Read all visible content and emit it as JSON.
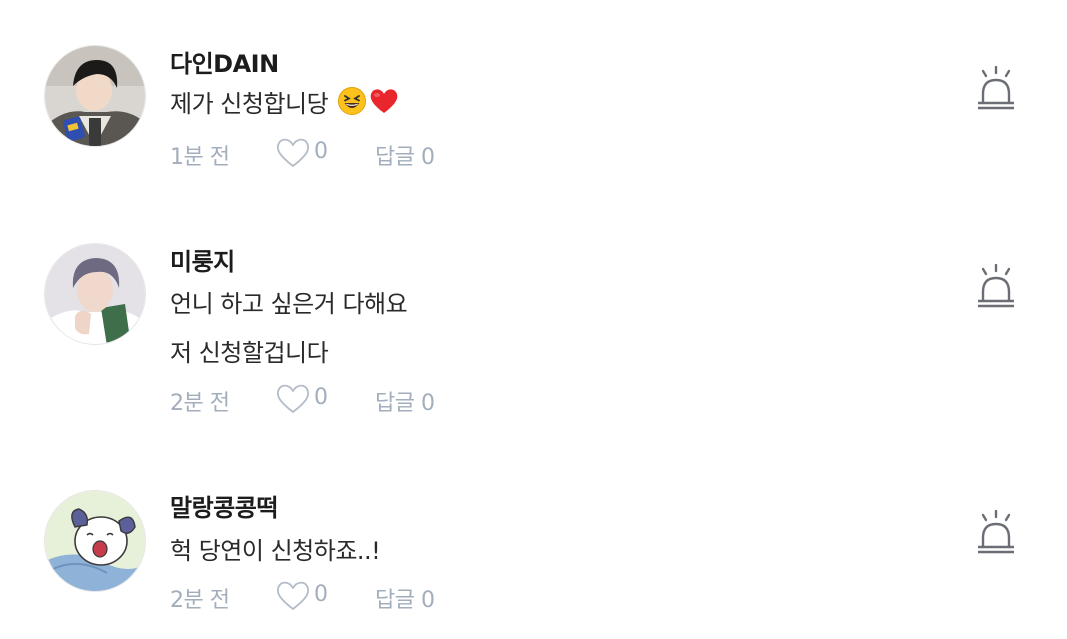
{
  "comments": [
    {
      "author": "다인DAIN",
      "lines": [
        "제가 신청합니당"
      ],
      "emojis": [
        "grinning-squint-face",
        "red-heart"
      ],
      "time": "1분 전",
      "likes": "0",
      "reply_label": "답글",
      "reply_count": "0",
      "avatar_icon": "profile-photo"
    },
    {
      "author": "미룽지",
      "lines": [
        "언니 하고 싶은거 다해요",
        "저 신청할겁니다"
      ],
      "time": "2분 전",
      "likes": "0",
      "reply_label": "답글",
      "reply_count": "0",
      "avatar_icon": "profile-photo"
    },
    {
      "author": "말랑콩콩떡",
      "lines": [
        "헉 당연이 신청하죠..!"
      ],
      "time": "2분 전",
      "likes": "0",
      "reply_label": "답글",
      "reply_count": "0",
      "avatar_icon": "cartoon-dog-avatar"
    }
  ],
  "icons": {
    "like": "heart-outline-icon",
    "report": "siren-alarm-icon"
  },
  "colors": {
    "meta_text": "#a3aebd",
    "report_icon": "#6b6f75",
    "heart_emoji": "#e8262b",
    "emoji_face": "#fcc21b"
  }
}
